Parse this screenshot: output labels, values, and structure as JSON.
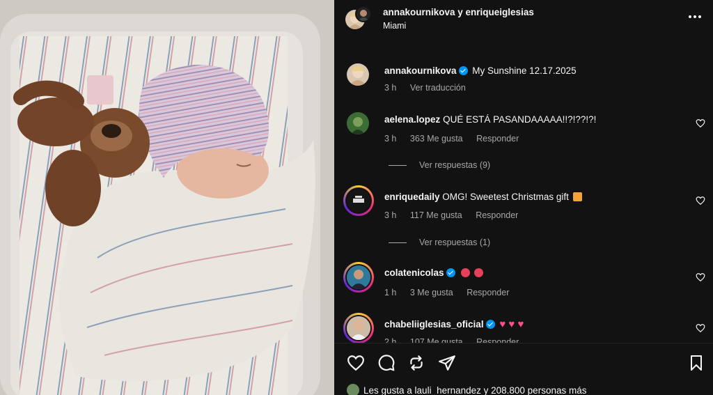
{
  "post": {
    "header_users": "annakournikova y enriqueiglesias",
    "location": "Miami",
    "more_icon": "more-horizontal-icon"
  },
  "caption": {
    "username": "annakournikova",
    "text": "My Sunshine 12.17.2025",
    "time": "3 h",
    "translate": "Ver traducción"
  },
  "comments": [
    {
      "username": "aelena.lopez",
      "text": "QUÉ ESTÁ PASANDAAAAA!!?!??!?!",
      "time": "3 h",
      "likes": "363 Me gusta",
      "reply": "Responder",
      "view_replies": "Ver respuestas (9)",
      "verified": false,
      "emoji": ""
    },
    {
      "username": "enriquedaily",
      "text": "OMG! Sweetest Christmas gift",
      "time": "3 h",
      "likes": "117 Me gusta",
      "reply": "Responder",
      "view_replies": "Ver respuestas (1)",
      "verified": false,
      "emoji": "gift"
    },
    {
      "username": "colatenicolas",
      "text": "",
      "time": "1 h",
      "likes": "3 Me gusta",
      "reply": "Responder",
      "view_replies": "",
      "verified": true,
      "emoji": "heart-eyes x2"
    },
    {
      "username": "chabeliiglesias_oficial",
      "text": "",
      "time": "2 h",
      "likes": "107 Me gusta",
      "reply": "Responder",
      "view_replies": "",
      "verified": true,
      "emoji": "pink-heart x3"
    }
  ],
  "footer": {
    "likes_text": "Les gusta a lauli_hernandez y 208.800 personas más"
  },
  "colors": {
    "background": "#121212",
    "verified": "#0095f6",
    "muted": "#a8a8a8",
    "heart_pink": "#ff4d8a"
  }
}
